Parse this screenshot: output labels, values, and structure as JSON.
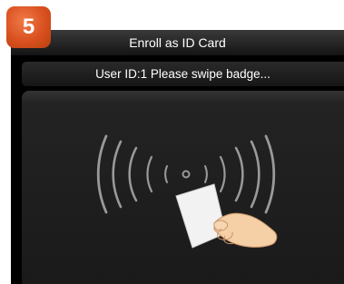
{
  "step": {
    "number": "5"
  },
  "header": {
    "title": "Enroll as ID Card"
  },
  "status": {
    "message": "User ID:1  Please swipe badge..."
  },
  "icons": [
    "rfid-waves-icon",
    "id-card-icon",
    "hand-icon"
  ],
  "colors": {
    "badge": "#d9501f",
    "screen": "#000000",
    "text": "#ffffff"
  }
}
